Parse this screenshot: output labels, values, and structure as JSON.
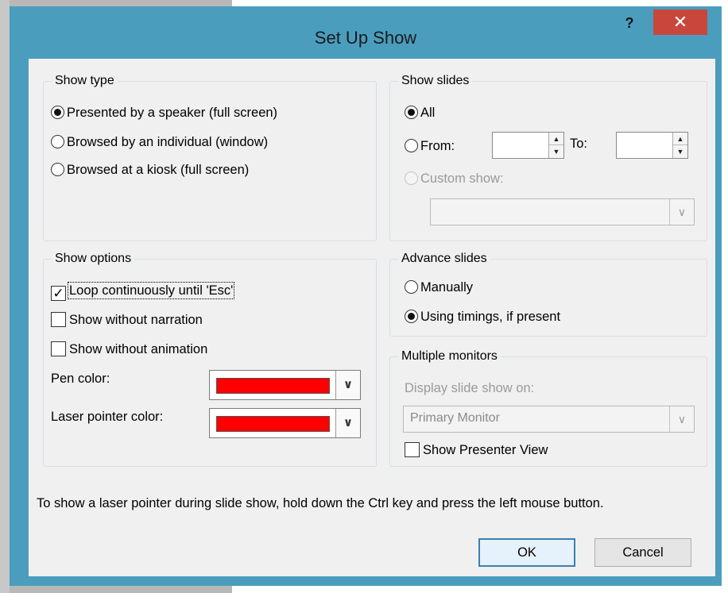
{
  "dialog": {
    "title": "Set Up Show",
    "help": "?",
    "close": "✕"
  },
  "show_type": {
    "legend": "Show type",
    "options": [
      {
        "label": "Presented by a speaker (full screen)",
        "checked": true
      },
      {
        "label": "Browsed by an individual (window)",
        "checked": false
      },
      {
        "label": "Browsed at a kiosk (full screen)",
        "checked": false
      }
    ]
  },
  "show_slides": {
    "legend": "Show slides",
    "all_label": "All",
    "from_label": "From:",
    "from_value": "",
    "to_label": "To:",
    "to_value": "",
    "custom_show_label": "Custom show:",
    "custom_show_value": ""
  },
  "show_options": {
    "legend": "Show options",
    "loop_label": "Loop continuously until 'Esc'",
    "loop_checked": true,
    "no_narration_label": "Show without narration",
    "no_narration_checked": false,
    "no_animation_label": "Show without animation",
    "no_animation_checked": false,
    "pen_color_label": "Pen color:",
    "pen_color": "#ff0000",
    "laser_color_label": "Laser pointer color:",
    "laser_color": "#ff0000"
  },
  "advance_slides": {
    "legend": "Advance slides",
    "manually_label": "Manually",
    "timings_label": "Using timings, if present"
  },
  "multiple_monitors": {
    "legend": "Multiple monitors",
    "display_label": "Display slide show on:",
    "display_value": "Primary Monitor",
    "presenter_view_label": "Show Presenter View"
  },
  "hint": "To show a laser pointer during slide show, hold down the Ctrl key and press the left mouse button.",
  "buttons": {
    "ok": "OK",
    "cancel": "Cancel"
  },
  "colors": {
    "title_bar": "#4a9dbd",
    "close_button": "#c9463d",
    "client": "#f0f0f0"
  }
}
